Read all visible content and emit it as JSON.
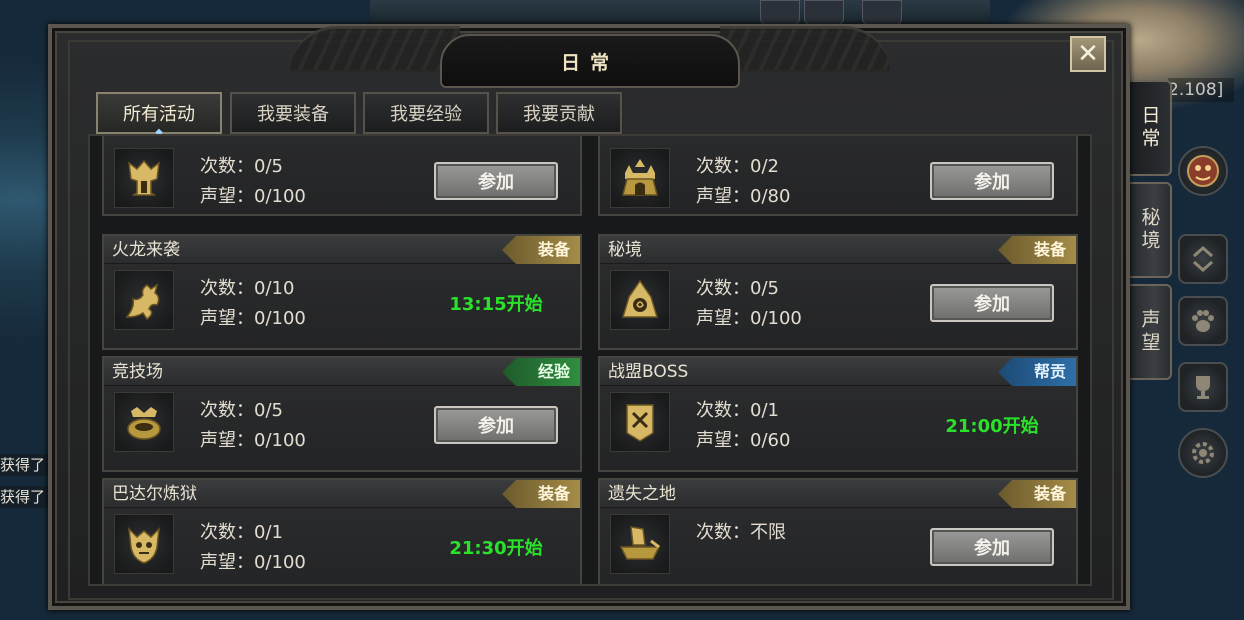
{
  "window": {
    "title": "日常",
    "close_symbol": "✕"
  },
  "tabs": [
    {
      "label": "所有活动",
      "active": true
    },
    {
      "label": "我要装备",
      "active": false
    },
    {
      "label": "我要经验",
      "active": false
    },
    {
      "label": "我要贡献",
      "active": false
    }
  ],
  "side_tabs": [
    {
      "label": "日常",
      "active": true
    },
    {
      "label": "秘境",
      "active": false
    },
    {
      "label": "声望",
      "active": false
    }
  ],
  "background": {
    "coord_text": "2.108]",
    "chat_lines": [
      "获得了",
      "获得了"
    ]
  },
  "labels": {
    "count_prefix": "次数：",
    "rep_prefix": "声望：",
    "join": "参加"
  },
  "activities": [
    {
      "name": "",
      "tag": "",
      "tag_type": "",
      "icon": "citadel-icon",
      "count": "0/5",
      "reputation": "0/100",
      "action": "join",
      "time": ""
    },
    {
      "name": "",
      "tag": "",
      "tag_type": "",
      "icon": "castle-icon",
      "count": "0/2",
      "reputation": "0/80",
      "action": "join",
      "time": ""
    },
    {
      "name": "火龙来袭",
      "tag": "装备",
      "tag_type": "equip",
      "icon": "dragon-icon",
      "count": "0/10",
      "reputation": "0/100",
      "action": "time",
      "time": "13:15开始"
    },
    {
      "name": "秘境",
      "tag": "装备",
      "tag_type": "equip",
      "icon": "portal-icon",
      "count": "0/5",
      "reputation": "0/100",
      "action": "join",
      "time": ""
    },
    {
      "name": "竞技场",
      "tag": "经验",
      "tag_type": "exp",
      "icon": "arena-icon",
      "count": "0/5",
      "reputation": "0/100",
      "action": "join",
      "time": ""
    },
    {
      "name": "战盟BOSS",
      "tag": "帮贡",
      "tag_type": "contrib",
      "icon": "banner-icon",
      "count": "0/1",
      "reputation": "0/60",
      "action": "time",
      "time": "21:00开始"
    },
    {
      "name": "巴达尔炼狱",
      "tag": "装备",
      "tag_type": "equip",
      "icon": "demon-icon",
      "count": "0/1",
      "reputation": "0/100",
      "action": "time",
      "time": "21:30开始"
    },
    {
      "name": "遗失之地",
      "tag": "装备",
      "tag_type": "equip",
      "icon": "ship-icon",
      "count": "不限",
      "reputation": "",
      "action": "join",
      "time": ""
    }
  ],
  "colors": {
    "time_green": "#2be22b",
    "tag_equip": "#a58c48",
    "tag_exp": "#2f8e3f",
    "tag_contrib": "#2d6fa8",
    "icon_gold": "#d7b865"
  }
}
